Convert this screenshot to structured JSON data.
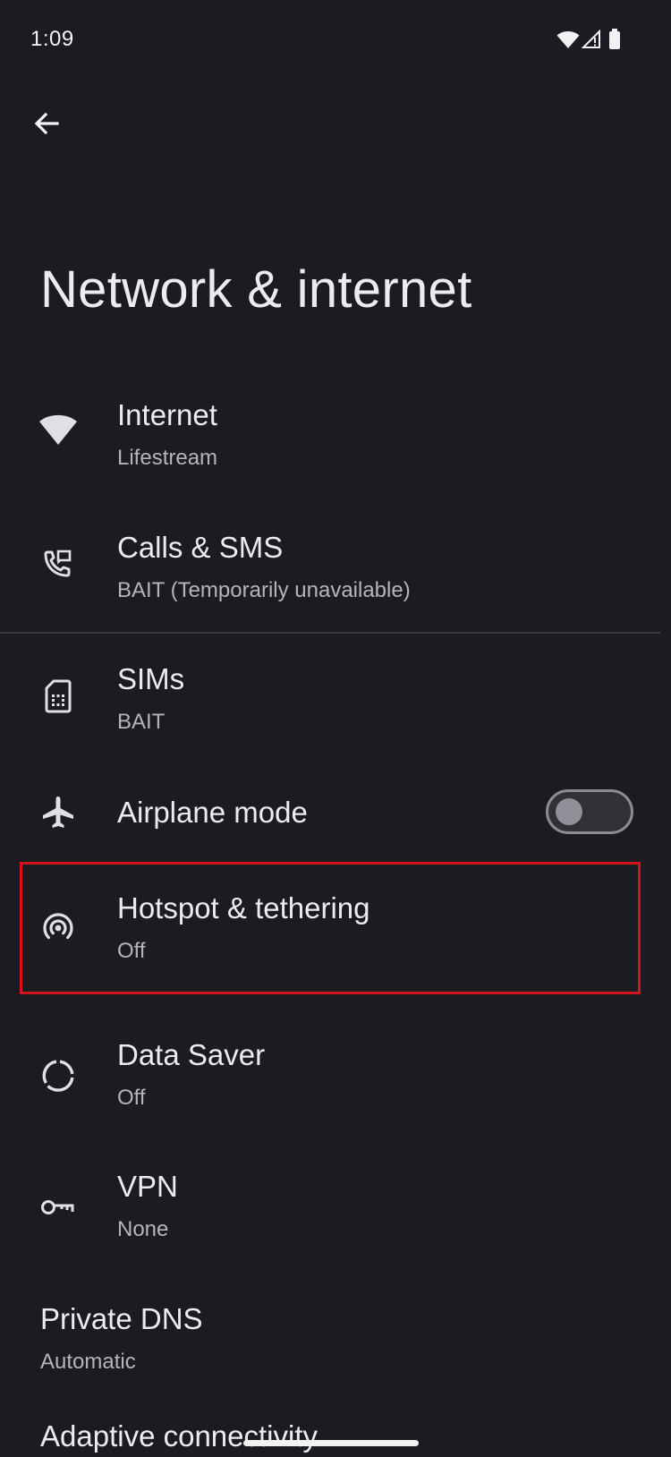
{
  "status_bar": {
    "time": "1:09",
    "icons": [
      "wifi-icon",
      "cell-signal-icon",
      "battery-icon"
    ]
  },
  "header": {
    "back_icon": "arrow-back-icon",
    "title": "Network & internet"
  },
  "settings": [
    {
      "id": "internet",
      "icon": "wifi-icon",
      "title": "Internet",
      "subtitle": "Lifestream"
    },
    {
      "id": "calls-sms",
      "icon": "phone-forward-icon",
      "title": "Calls & SMS",
      "subtitle": "BAIT (Temporarily unavailable)"
    },
    {
      "id": "sims",
      "icon": "sim-card-icon",
      "title": "SIMs",
      "subtitle": "BAIT"
    },
    {
      "id": "airplane-mode",
      "icon": "airplane-icon",
      "title": "Airplane mode",
      "toggle_on": false
    },
    {
      "id": "hotspot",
      "icon": "hotspot-icon",
      "title": "Hotspot & tethering",
      "subtitle": "Off"
    },
    {
      "id": "data-saver",
      "icon": "data-saver-icon",
      "title": "Data Saver",
      "subtitle": "Off"
    },
    {
      "id": "vpn",
      "icon": "key-icon",
      "title": "VPN",
      "subtitle": "None"
    },
    {
      "id": "private-dns",
      "title": "Private DNS",
      "subtitle": "Automatic"
    },
    {
      "id": "adaptive-connectivity",
      "title": "Adaptive connectivity"
    }
  ],
  "colors": {
    "background": "#1b1c21",
    "highlight": "#d4141c",
    "text_primary": "#ececef",
    "text_secondary": "#b4b5bc"
  }
}
